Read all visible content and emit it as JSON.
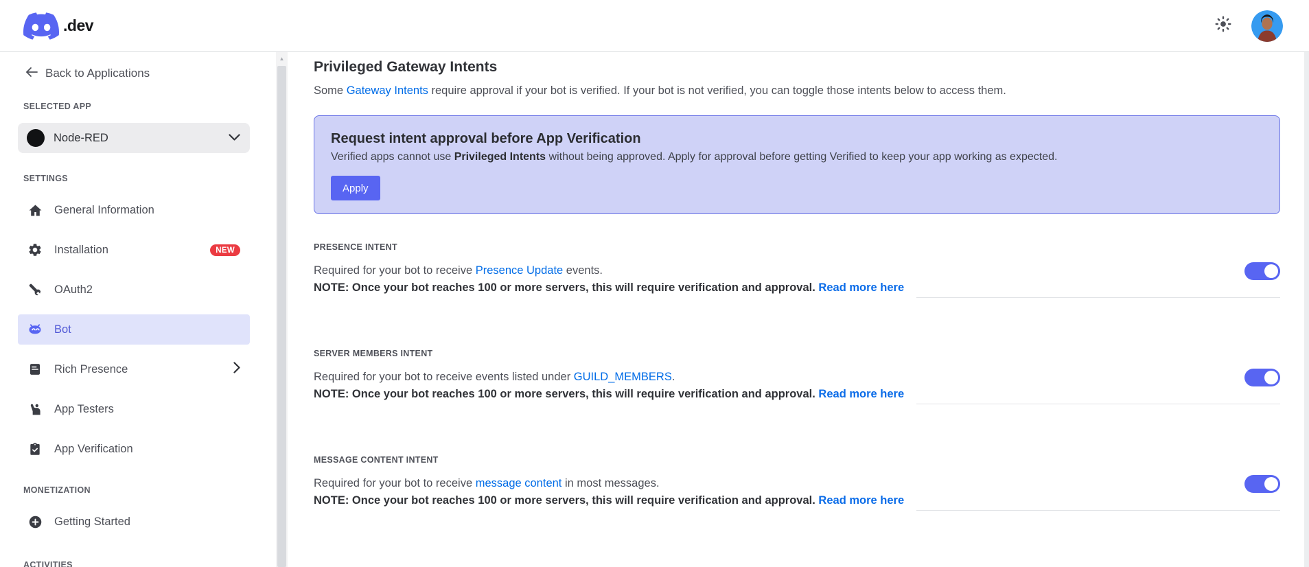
{
  "colors": {
    "accent_blurple": "#5865F2",
    "link_blue": "#006ce7",
    "badge_red": "#eb3b42",
    "banner_bg": "#cfd2f7",
    "banner_border": "#6973e6",
    "selected_nav_bg": "#e0e3fb",
    "toggle_on": "#5865F2"
  },
  "header": {
    "logo_suffix": ".dev",
    "icons": [
      "discord-logo-icon",
      "sun-theme-icon",
      "user-avatar"
    ]
  },
  "sidebar": {
    "back_label": "Back to Applications",
    "selected_app_heading": "SELECTED APP",
    "app_name": "Node-RED",
    "settings_heading": "SETTINGS",
    "items": [
      {
        "label": "General Information",
        "icon": "home-icon"
      },
      {
        "label": "Installation",
        "icon": "gear-icon",
        "badge": "NEW"
      },
      {
        "label": "OAuth2",
        "icon": "wrench-icon"
      },
      {
        "label": "Bot",
        "icon": "bot-icon",
        "selected": true
      },
      {
        "label": "Rich Presence",
        "icon": "journal-icon",
        "chevron": true
      },
      {
        "label": "App Testers",
        "icon": "person-raised-hand-icon"
      },
      {
        "label": "App Verification",
        "icon": "clipboard-check-icon"
      }
    ],
    "monetization_heading": "MONETIZATION",
    "monetization_items": [
      {
        "label": "Getting Started",
        "icon": "plus-circle-icon"
      }
    ],
    "activities_heading": "ACTIVITIES"
  },
  "main": {
    "title": "Privileged Gateway Intents",
    "intro": {
      "before": "Some ",
      "link": "Gateway Intents",
      "after": " require approval if your bot is verified. If your bot is not verified, you can toggle those intents below to access them."
    },
    "banner": {
      "title": "Request intent approval before App Verification",
      "body_before": "Verified apps cannot use ",
      "body_bold": "Privileged Intents",
      "body_after": " without being approved. Apply for approval before getting Verified to keep your app working as expected.",
      "button_label": "Apply"
    },
    "intents": [
      {
        "label": "PRESENCE INTENT",
        "desc_before": "Required for your bot to receive ",
        "desc_link": "Presence Update",
        "desc_after": " events.",
        "note": "NOTE: Once your bot reaches 100 or more servers, this will require verification and approval.",
        "note_link": "Read more here",
        "enabled": true
      },
      {
        "label": "SERVER MEMBERS INTENT",
        "desc_before": "Required for your bot to receive events listed under ",
        "desc_link": "GUILD_MEMBERS",
        "desc_after": ".",
        "note": "NOTE: Once your bot reaches 100 or more servers, this will require verification and approval.",
        "note_link": "Read more here",
        "enabled": true
      },
      {
        "label": "MESSAGE CONTENT INTENT",
        "desc_before": "Required for your bot to receive ",
        "desc_link": "message content",
        "desc_after": " in most messages.",
        "note": "NOTE: Once your bot reaches 100 or more servers, this will require verification and approval.",
        "note_link": "Read more here",
        "enabled": true
      }
    ]
  }
}
